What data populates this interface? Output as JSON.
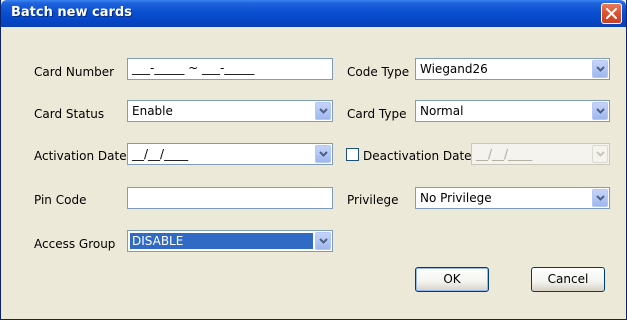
{
  "window": {
    "title": "Batch new cards"
  },
  "form": {
    "card_number": {
      "label": "Card Number",
      "value": "___-_____ ~ ___-_____"
    },
    "card_status": {
      "label": "Card Status",
      "value": "Enable"
    },
    "activation_date": {
      "label": "Activation Date",
      "value": "__/__/____"
    },
    "pin_code": {
      "label": "Pin Code",
      "value": ""
    },
    "access_group": {
      "label": "Access Group",
      "value": "DISABLE"
    },
    "code_type": {
      "label": "Code Type",
      "value": "Wiegand26"
    },
    "card_type": {
      "label": "Card Type",
      "value": "Normal"
    },
    "deactivation_date": {
      "label": "Deactivation Date",
      "value": "__/__/____",
      "checked": false
    },
    "privilege": {
      "label": "Privilege",
      "value": "No Privilege"
    }
  },
  "buttons": {
    "ok": "OK",
    "cancel": "Cancel"
  },
  "colors": {
    "titlebar": "#0a4fd0",
    "dialog_bg": "#ece9d8",
    "selection": "#316ac5",
    "close_button": "#d9532f"
  }
}
